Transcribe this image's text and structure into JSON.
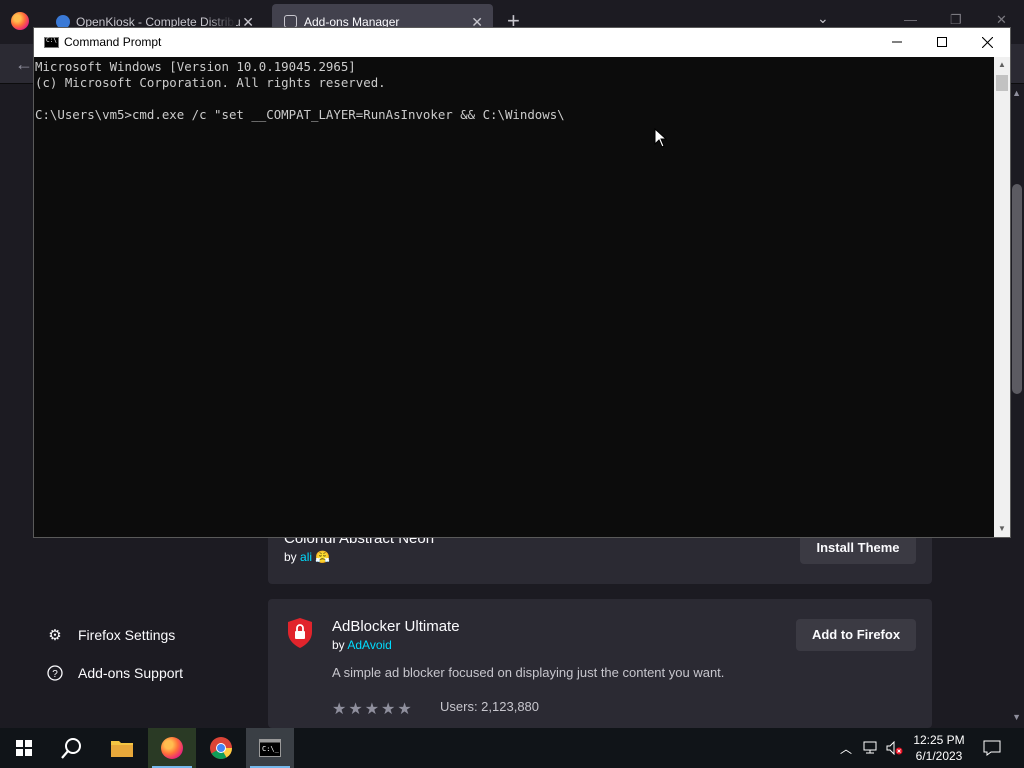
{
  "firefox": {
    "tabs": [
      {
        "label": "OpenKiosk - Complete Distribu",
        "icon": "openkiosk-icon"
      },
      {
        "label": "Add-ons Manager",
        "icon": "puzzle-icon"
      }
    ],
    "new_tab_glyph": "+",
    "sidebar": [
      {
        "label": "Firefox Settings",
        "icon": "gear-icon"
      },
      {
        "label": "Add-ons Support",
        "icon": "help-icon"
      }
    ],
    "cards": {
      "theme": {
        "title": "Colorful Abstract Neon",
        "by_prefix": "by ",
        "author": "ali",
        "author_emoji": "😤",
        "button": "Install Theme"
      },
      "adblock": {
        "title": "AdBlocker Ultimate",
        "by_prefix": "by ",
        "author": "AdAvoid",
        "description": "A simple ad blocker focused on displaying just the content you want.",
        "rating_stars": 5,
        "users": "Users: 2,123,880",
        "button": "Add to Firefox"
      }
    }
  },
  "cmd": {
    "title": "Command Prompt",
    "lines": [
      "Microsoft Windows [Version 10.0.19045.2965]",
      "(c) Microsoft Corporation. All rights reserved.",
      "",
      "C:\\Users\\vm5>cmd.exe /c \"set __COMPAT_LAYER=RunAsInvoker && C:\\Windows\\"
    ],
    "colors": {
      "background": "#0c0c0c",
      "text": "#cccccc"
    }
  },
  "taskbar": {
    "apps": [
      {
        "name": "start-button",
        "icon": "windows-icon"
      },
      {
        "name": "search-button",
        "icon": "search-icon"
      },
      {
        "name": "file-explorer",
        "icon": "folder-icon"
      },
      {
        "name": "firefox",
        "icon": "firefox-icon"
      },
      {
        "name": "chrome",
        "icon": "chrome-icon"
      },
      {
        "name": "command-prompt",
        "icon": "cmd-icon"
      }
    ],
    "time": "12:25 PM",
    "date": "6/1/2023"
  }
}
